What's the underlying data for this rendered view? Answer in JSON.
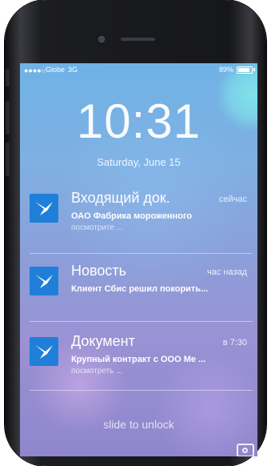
{
  "status_bar": {
    "signal_dots": "●●●●○",
    "carrier": "Globe",
    "network": "3G",
    "battery_percent": "89%",
    "battery_level": 0.89
  },
  "lock_screen": {
    "time": "10:31",
    "date": "Saturday, June 15",
    "slide_text": "slide to unlock"
  },
  "notifications": [
    {
      "title": "Входящий док.",
      "time": "сейчас",
      "body": "ОАО Фабрика мороженного",
      "more": "посмотрите ..."
    },
    {
      "title": "Новость",
      "time": "час назад",
      "body": "Клиент Сбис решил покорить...",
      "more": ""
    },
    {
      "title": "Документ",
      "time": "в 7:30",
      "body": "Крупный контракт с ООО Ме ...",
      "more": "посмотреть ..."
    }
  ],
  "icons": {
    "notification_icon": "sbis-logo-icon",
    "camera": "camera-icon"
  },
  "colors": {
    "icon_bg": "#1f7fd9"
  }
}
